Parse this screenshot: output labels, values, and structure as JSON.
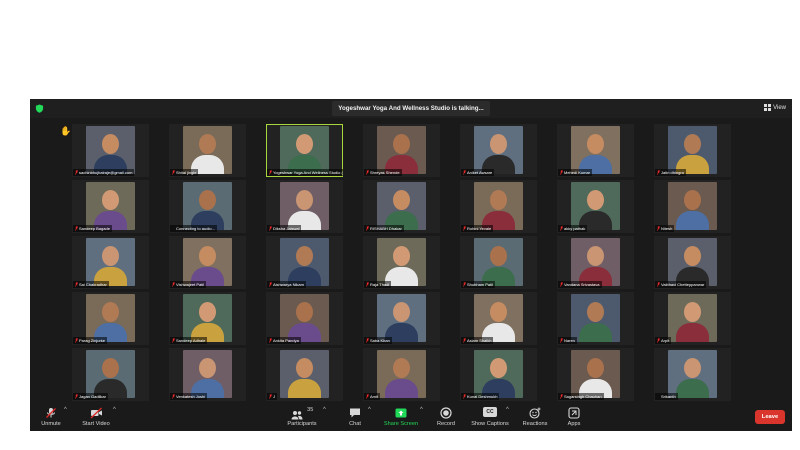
{
  "meeting": {
    "talking_banner": "Yogeshwar Yoga And Wellness Studio is talking...",
    "view_label": "View",
    "raised_hand_icon": "raised-hand-icon"
  },
  "participants": [
    {
      "name": "sachinbhujbalraje@gmail.com",
      "muted": true,
      "raised_hand": true
    },
    {
      "name": "Shital jingle",
      "muted": true
    },
    {
      "name": "Yogeshwar Yoga And Wellness Studio (Yoga...",
      "muted": true,
      "speaking": true
    },
    {
      "name": "Shreyas Shende",
      "muted": true
    },
    {
      "name": "Aniket Awsare",
      "muted": true
    },
    {
      "name": "Mehedi Kumar",
      "muted": true
    },
    {
      "name": "Jatin dhingra",
      "muted": true
    },
    {
      "name": "Sandeep Bagade",
      "muted": true
    },
    {
      "name": "Connecting to audio...",
      "muted": false
    },
    {
      "name": "Diksha Jaiswal",
      "muted": true
    },
    {
      "name": "RISHABH Dhakar",
      "muted": true
    },
    {
      "name": "Rohini Yevale",
      "muted": true
    },
    {
      "name": "akky pathak",
      "muted": true
    },
    {
      "name": "Nitesh",
      "muted": true
    },
    {
      "name": "Sai Chakradhar",
      "muted": true
    },
    {
      "name": "Vishwajeet Patil",
      "muted": true
    },
    {
      "name": "Aishwarya Nikam",
      "muted": true
    },
    {
      "name": "Raja Thadi",
      "muted": true
    },
    {
      "name": "Shubham Patil",
      "muted": true
    },
    {
      "name": "Vandana Srivastava",
      "muted": true
    },
    {
      "name": "Vaibhavi Chetteppanwar",
      "muted": true
    },
    {
      "name": "Parag Zinjurke",
      "muted": true
    },
    {
      "name": "Sandeep Adhale",
      "muted": true
    },
    {
      "name": "Ankita Pandya",
      "muted": true
    },
    {
      "name": "Saba Khan",
      "muted": true
    },
    {
      "name": "Aslam Shaikh",
      "muted": true
    },
    {
      "name": "Naren",
      "muted": true
    },
    {
      "name": "Arpit",
      "muted": true
    },
    {
      "name": "Jagan Gadilkar",
      "muted": true
    },
    {
      "name": "Venkatesh Joshi",
      "muted": true
    },
    {
      "name": "J",
      "muted": true
    },
    {
      "name": "Amit",
      "muted": true
    },
    {
      "name": "Kunal Deshmukh",
      "muted": true
    },
    {
      "name": "Sagarsingh Chauhan",
      "muted": true
    },
    {
      "name": "Srikanth",
      "muted": false
    }
  ],
  "toolbar": {
    "unmute": "Unmute",
    "start_video": "Start Video",
    "participants": "Participants",
    "participants_count": "35",
    "chat": "Chat",
    "share_screen": "Share Screen",
    "record": "Record",
    "show_captions": "Show Captions",
    "reactions": "Reactions",
    "apps": "Apps",
    "leave": "Leave",
    "captions_badge": "CC"
  },
  "colors": {
    "speaking_border": "#a8d63c",
    "share_green": "#23d959",
    "leave_red": "#d9352c",
    "muted_red": "#e02828"
  }
}
